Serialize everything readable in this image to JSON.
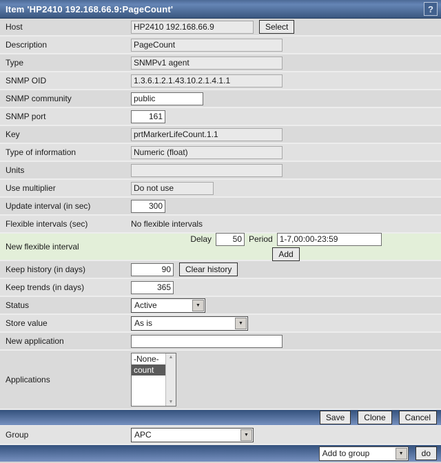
{
  "colors": {
    "titlebar_blue_top": "#4c6a96",
    "titlebar_blue_bottom": "#3a577f",
    "bar_blue_top": "#34517d",
    "bar_blue_bottom": "#7690bf",
    "row_gray": "#dadada",
    "row_gray_alt": "#e1e1e1",
    "new_interval_green": "#e3efd9",
    "selected_option_bg": "#5a5a5a"
  },
  "titlebar": {
    "title": "Item 'HP2410 192.168.66.9:PageCount'",
    "help": "?"
  },
  "fields": {
    "host": {
      "label": "Host",
      "value": "HP2410 192.168.66.9",
      "select_button": "Select"
    },
    "description": {
      "label": "Description",
      "value": "PageCount"
    },
    "type": {
      "label": "Type",
      "value": "SNMPv1 agent"
    },
    "snmp_oid": {
      "label": "SNMP OID",
      "value": "1.3.6.1.2.1.43.10.2.1.4.1.1"
    },
    "snmp_community": {
      "label": "SNMP community",
      "value": "public"
    },
    "snmp_port": {
      "label": "SNMP port",
      "value": "161"
    },
    "key": {
      "label": "Key",
      "value": "prtMarkerLifeCount.1.1"
    },
    "type_of_information": {
      "label": "Type of information",
      "value": "Numeric (float)"
    },
    "units": {
      "label": "Units",
      "value": ""
    },
    "use_multiplier": {
      "label": "Use multiplier",
      "value": "Do not use"
    },
    "update_interval": {
      "label": "Update interval (in sec)",
      "value": "300"
    },
    "flexible_intervals": {
      "label": "Flexible intervals (sec)",
      "value": "No flexible intervals"
    },
    "new_flexible_interval": {
      "label": "New flexible interval",
      "delay_label": "Delay",
      "delay_value": "50",
      "period_label": "Period",
      "period_value": "1-7,00:00-23:59",
      "add_button": "Add"
    },
    "keep_history": {
      "label": "Keep history (in days)",
      "value": "90",
      "clear_button": "Clear history"
    },
    "keep_trends": {
      "label": "Keep trends (in days)",
      "value": "365"
    },
    "status": {
      "label": "Status",
      "value": "Active"
    },
    "store_value": {
      "label": "Store value",
      "value": "As is"
    },
    "new_application": {
      "label": "New application",
      "value": ""
    },
    "applications": {
      "label": "Applications",
      "options": [
        "-None-",
        "count"
      ],
      "selected": "count"
    }
  },
  "footer": {
    "save": "Save",
    "clone": "Clone",
    "cancel": "Cancel"
  },
  "group_row": {
    "label": "Group",
    "value": "APC"
  },
  "action_bar": {
    "selected_action": "Add to group",
    "do_button": "do"
  }
}
